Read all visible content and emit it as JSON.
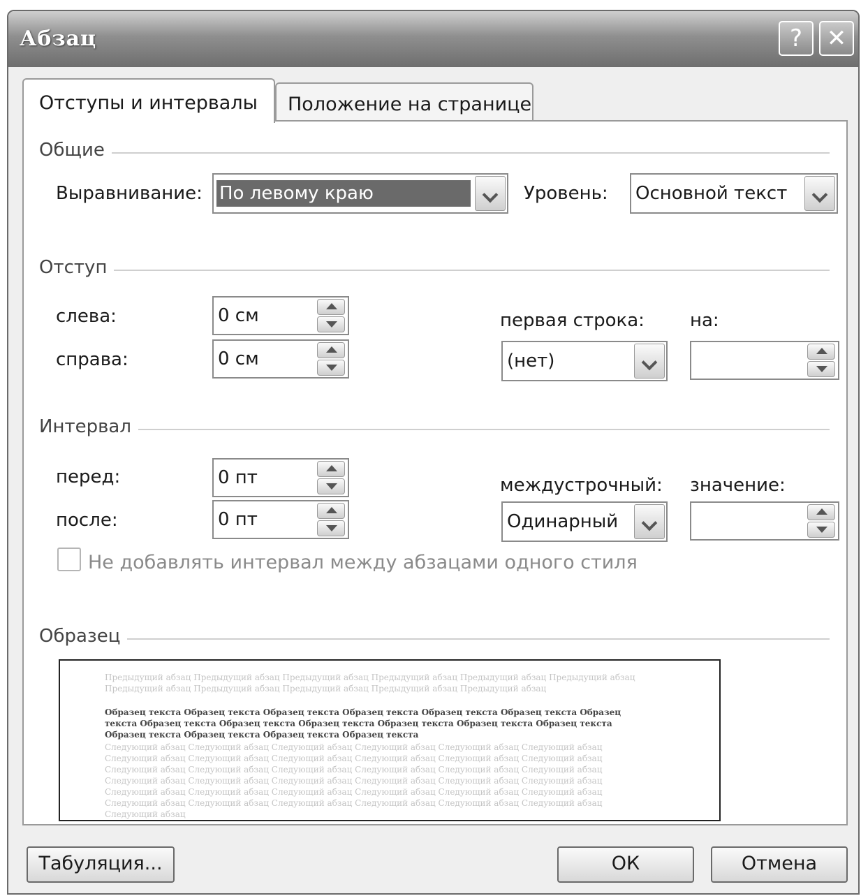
{
  "window": {
    "title": "Абзац",
    "help_label": "?",
    "close_label": "✕"
  },
  "tabs": [
    {
      "label": "Отступы и интервалы",
      "active": true
    },
    {
      "label": "Положение на странице",
      "active": false
    }
  ],
  "general": {
    "group_label": "Общие",
    "alignment_label": "Выравнивание:",
    "alignment_value": "По левому краю",
    "level_label": "Уровень:",
    "level_value": "Основной текст"
  },
  "indent": {
    "group_label": "Отступ",
    "left_label": "слева:",
    "left_value": "0 см",
    "right_label": "справа:",
    "right_value": "0 см",
    "first_line_label": "первая строка:",
    "first_line_value": "(нет)",
    "by_label": "на:",
    "by_value": ""
  },
  "spacing": {
    "group_label": "Интервал",
    "before_label": "перед:",
    "before_value": "0 пт",
    "after_label": "после:",
    "after_value": "0 пт",
    "line_spacing_label": "междустрочный:",
    "line_spacing_value": "Одинарный",
    "at_label": "значение:",
    "at_value": "",
    "no_space_checkbox_label": "Не добавлять интервал между абзацами одного стиля",
    "no_space_checked": false
  },
  "preview": {
    "group_label": "Образец",
    "previous_text": "Предыдущий абзац Предыдущий абзац Предыдущий абзац Предыдущий абзац Предыдущий абзац Предыдущий абзац Предыдущий абзац Предыдущий абзац Предыдущий абзац Предыдущий абзац Предыдущий абзац",
    "sample_text": "Образец текста Образец текста Образец текста Образец текста Образец текста Образец текста Образец текста Образец текста Образец текста Образец текста Образец текста Образец текста Образец текста Образец текста Образец текста Образец текста Образец текста",
    "next_text": "Следующий абзац Следующий абзац Следующий абзац Следующий абзац Следующий абзац Следующий абзац Следующий абзац Следующий абзац Следующий абзац Следующий абзац Следующий абзац Следующий абзац Следующий абзац Следующий абзац Следующий абзац Следующий абзац Следующий абзац Следующий абзац Следующий абзац Следующий абзац Следующий абзац Следующий абзац Следующий абзац Следующий абзац Следующий абзац Следующий абзац Следующий абзац Следующий абзац Следующий абзац Следующий абзац Следующий абзац Следующий абзац Следующий абзац Следующий абзац Следующий абзац Следующий абзац Следующий абзац"
  },
  "buttons": {
    "tabs_label": "Табуляция...",
    "ok_label": "ОК",
    "cancel_label": "Отмена"
  }
}
